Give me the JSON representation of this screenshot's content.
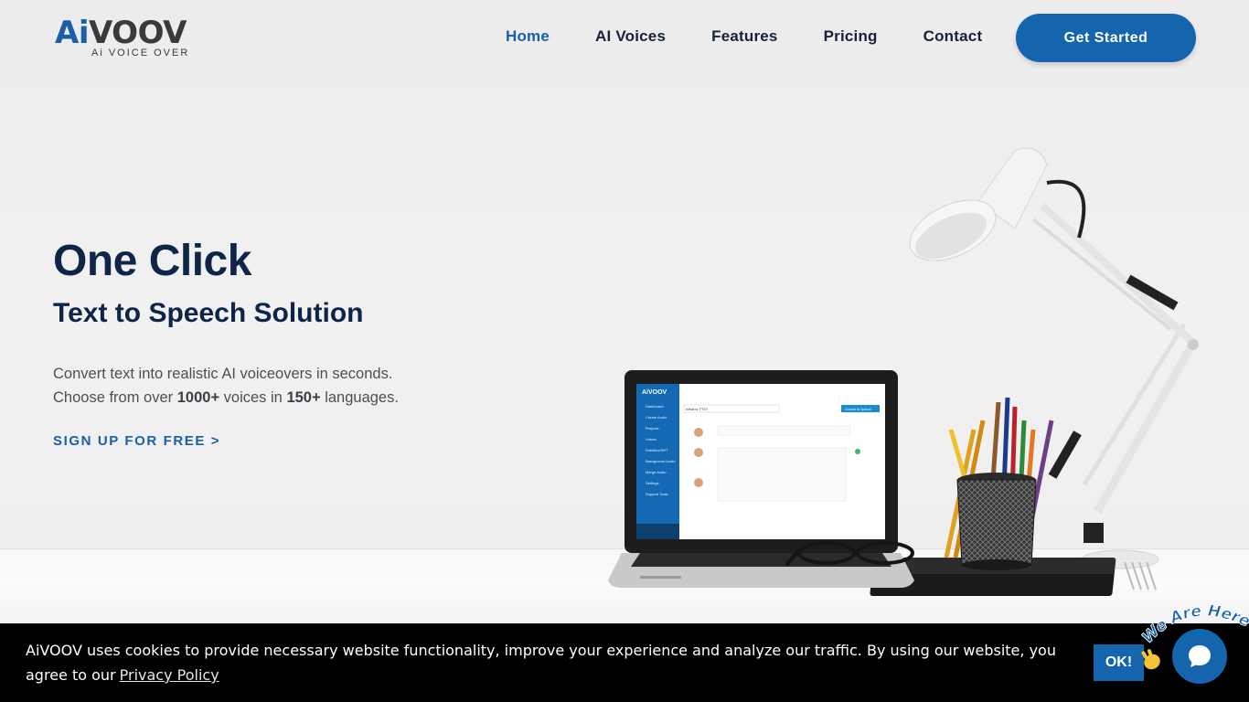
{
  "header": {
    "logo_main_a": "Ai",
    "logo_main_b": "VOOV",
    "logo_sub": "Ai VOICE OVER",
    "nav": [
      {
        "label": "Home",
        "active": true
      },
      {
        "label": "AI Voices",
        "active": false
      },
      {
        "label": "Features",
        "active": false
      },
      {
        "label": "Pricing",
        "active": false
      },
      {
        "label": "Contact",
        "active": false
      }
    ],
    "cta_label": "Get Started"
  },
  "hero": {
    "title": "One Click",
    "subtitle": "Text to Speech Solution",
    "desc_line1": "Convert text into realistic AI voiceovers in seconds.",
    "desc_line2_a": "Choose from over ",
    "desc_line2_voices": "1000+",
    "desc_line2_b": " voices in ",
    "desc_line2_langs": "150+",
    "desc_line2_c": " languages.",
    "signup_label": "SIGN UP FOR FREE >"
  },
  "laptop_screen": {
    "brand": "AiVOOV",
    "menu": [
      "Dashboard",
      "Create Audio",
      "Projects",
      "Voices",
      "Subtitles/SRT",
      "Background Audio",
      "Merge Audio",
      "Settings",
      "Support Tools"
    ],
    "input_value": "What is TTS?",
    "convert_label": "Convert to Speech"
  },
  "cookie": {
    "text": "AiVOOV uses cookies to provide necessary website functionality, improve your experience and analyze our traffic. By using our website, you agree to our",
    "link": "Privacy Policy",
    "ok_label": "OK!"
  },
  "chat": {
    "bubble_text": "We Are Here!",
    "icon": "chat-bubble-icon",
    "wave_icon": "waving-hand-icon"
  },
  "colors": {
    "brand": "#1565ae",
    "heading": "#0e2548",
    "cookie_bg": "#000000"
  }
}
